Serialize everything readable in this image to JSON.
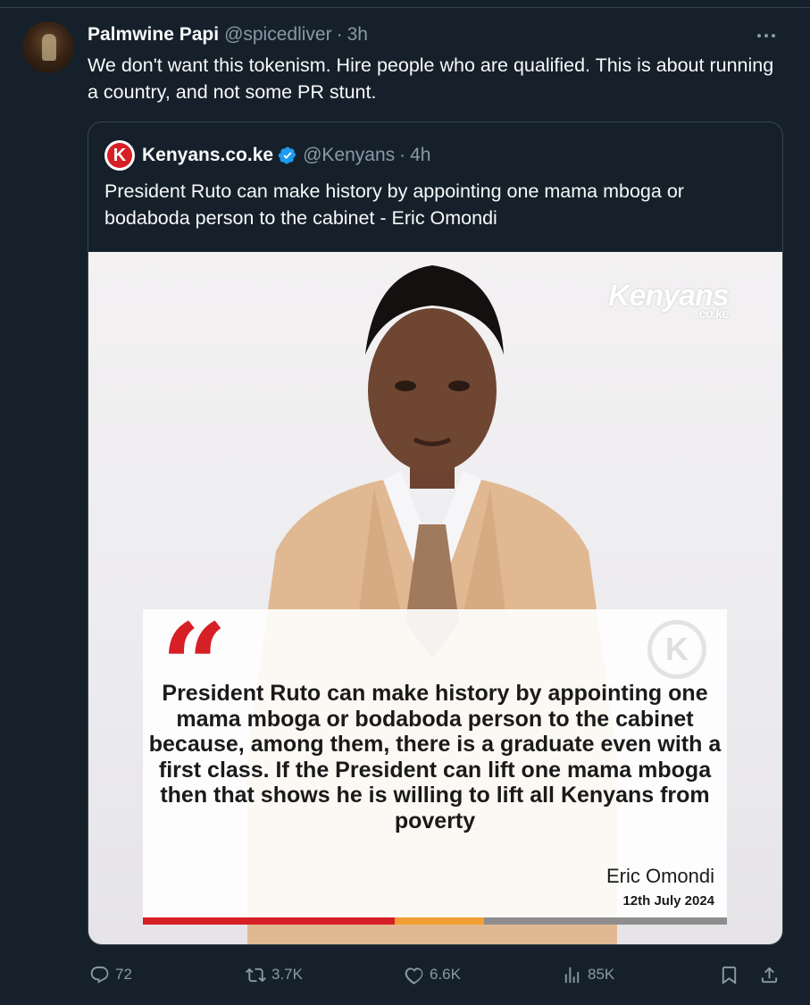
{
  "tweet": {
    "author_name": "Palmwine Papi",
    "handle": "@spicedliver",
    "separator": "·",
    "time": "3h",
    "text": "We don't want this tokenism. Hire people who are qualified. This is about running a country, and not some PR stunt."
  },
  "quoted": {
    "author_name": "Kenyans.co.ke",
    "handle": "@Kenyans",
    "separator": "·",
    "time": "4h",
    "text": "President Ruto can make history by appointing one mama mboga or bodaboda person to the cabinet - Eric Omondi",
    "image": {
      "watermark": "Kenyans",
      "watermark_sub": ".co.ke",
      "quote_mark": "“",
      "quote": "President Ruto can make history by appointing one mama mboga or bodaboda person to the cabinet because, among them, there is a graduate even with a first class. If the President can lift one mama mboga then that shows he is willing to lift all Kenyans from poverty",
      "author": "Eric Omondi",
      "date": "12th July 2024",
      "card_logo": "K"
    },
    "logo_letter": "K"
  },
  "actions": {
    "reply_count": "72",
    "retweet_count": "3.7K",
    "like_count": "6.6K",
    "view_count": "85K"
  },
  "icons": [
    "more-icon",
    "verified-icon",
    "reply-icon",
    "retweet-icon",
    "like-icon",
    "views-icon",
    "bookmark-icon",
    "share-icon"
  ],
  "colors": {
    "background": "#15202b",
    "text": "#f7f9f9",
    "muted": "#8b98a5",
    "border": "#38444d",
    "verified": "#1d9bf0",
    "brand_red": "#d71f26"
  }
}
